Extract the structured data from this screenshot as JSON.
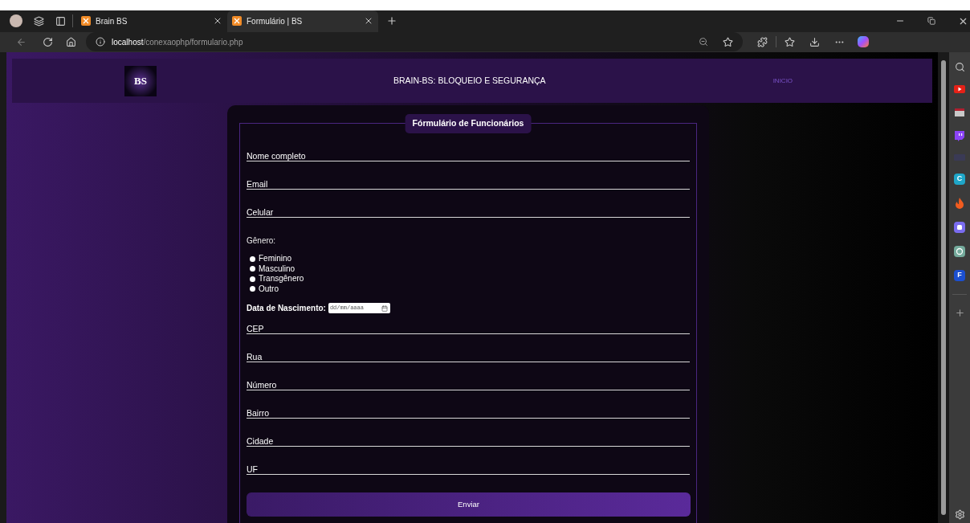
{
  "browser": {
    "tabs": [
      {
        "title": "Brain BS",
        "selected": false
      },
      {
        "title": "Formulário | BS",
        "selected": true
      }
    ],
    "url_host": "localhost",
    "url_path": "/conexaophp/formulario.php",
    "sidebar_apps": [
      {
        "kind": "youtube",
        "color": "#e62117"
      },
      {
        "kind": "cake",
        "color": "#c9c9c9"
      },
      {
        "kind": "twitch",
        "color": "#8b44f7"
      },
      {
        "kind": "faint",
        "color": "#3a3a55"
      },
      {
        "kind": "letter",
        "color": "#1fa6c8",
        "label": "C"
      },
      {
        "kind": "flame",
        "color": "#f25c1f"
      },
      {
        "kind": "app",
        "color": "#7a6cf0"
      },
      {
        "kind": "chat",
        "color": "#74aa9c"
      },
      {
        "kind": "letter",
        "color": "#1b4fd1",
        "label": "F"
      }
    ]
  },
  "header": {
    "logo": "BS",
    "title": "BRAIN-BS: BLOQUEIO E SEGURANÇA",
    "nav_link": "INICIO"
  },
  "form": {
    "legend": "Fórmulário de Funcionários",
    "fields_top": [
      {
        "label": "Nome completo"
      },
      {
        "label": "Email"
      },
      {
        "label": "Celular"
      }
    ],
    "gender": {
      "label": "Gênero:",
      "options": [
        {
          "label": "Feminino",
          "selected": false
        },
        {
          "label": "Masculino",
          "selected": false
        },
        {
          "label": "Transgênero",
          "selected": false
        },
        {
          "label": "Outro",
          "selected": false
        }
      ]
    },
    "birth": {
      "label": "Data de Nascimento:",
      "placeholder": "dd/mm/aaaa"
    },
    "fields_bottom": [
      {
        "label": "CEP"
      },
      {
        "label": "Rua"
      },
      {
        "label": "Número"
      },
      {
        "label": "Bairro"
      },
      {
        "label": "Cidade"
      },
      {
        "label": "UF"
      }
    ],
    "submit": "Enviar"
  }
}
